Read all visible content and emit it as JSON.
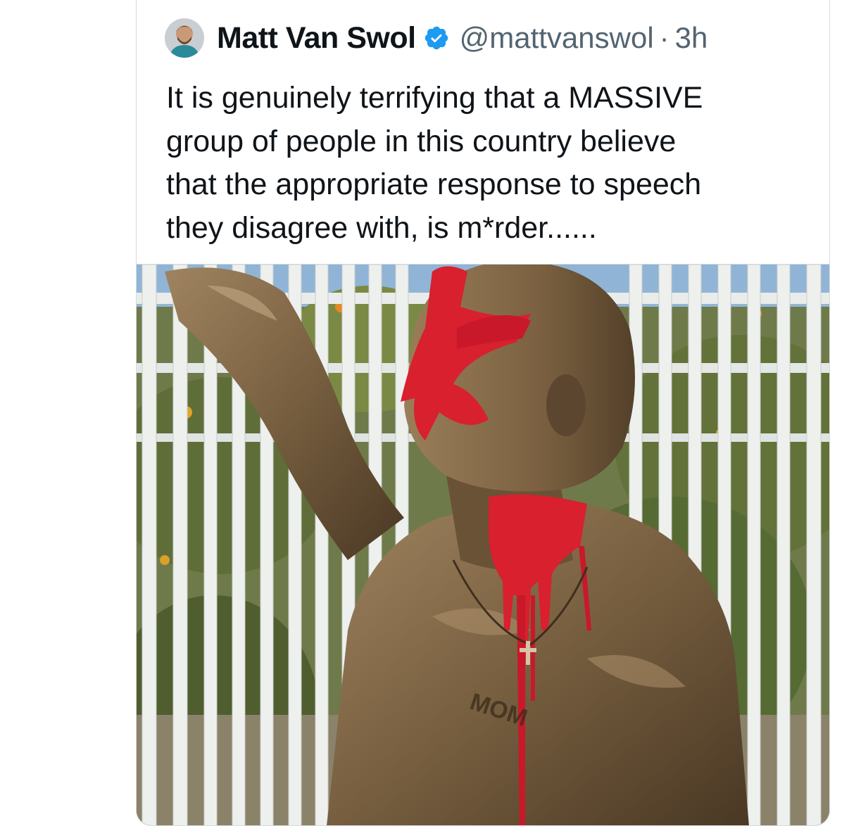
{
  "tweet": {
    "author_name": "Matt Van Swol",
    "handle": "@mattvanswol",
    "separator": "·",
    "time": "3h",
    "text_lines": [
      "It is genuinely terrifying that a MASSIVE",
      "group of people in this country believe",
      "that the appropriate response to speech",
      "they disagree with, is m*rder......"
    ],
    "media": {
      "kind": "photo",
      "chest_lettering": "MOM"
    }
  },
  "icons": {
    "verified": "verified-badge-icon",
    "avatar": "profile-avatar"
  },
  "colors": {
    "verified_blue": "#1d9bf0",
    "name_text": "#0f1419",
    "secondary_text": "#536471",
    "paint_red": "#d8202e",
    "bronze": "#7b6242"
  }
}
